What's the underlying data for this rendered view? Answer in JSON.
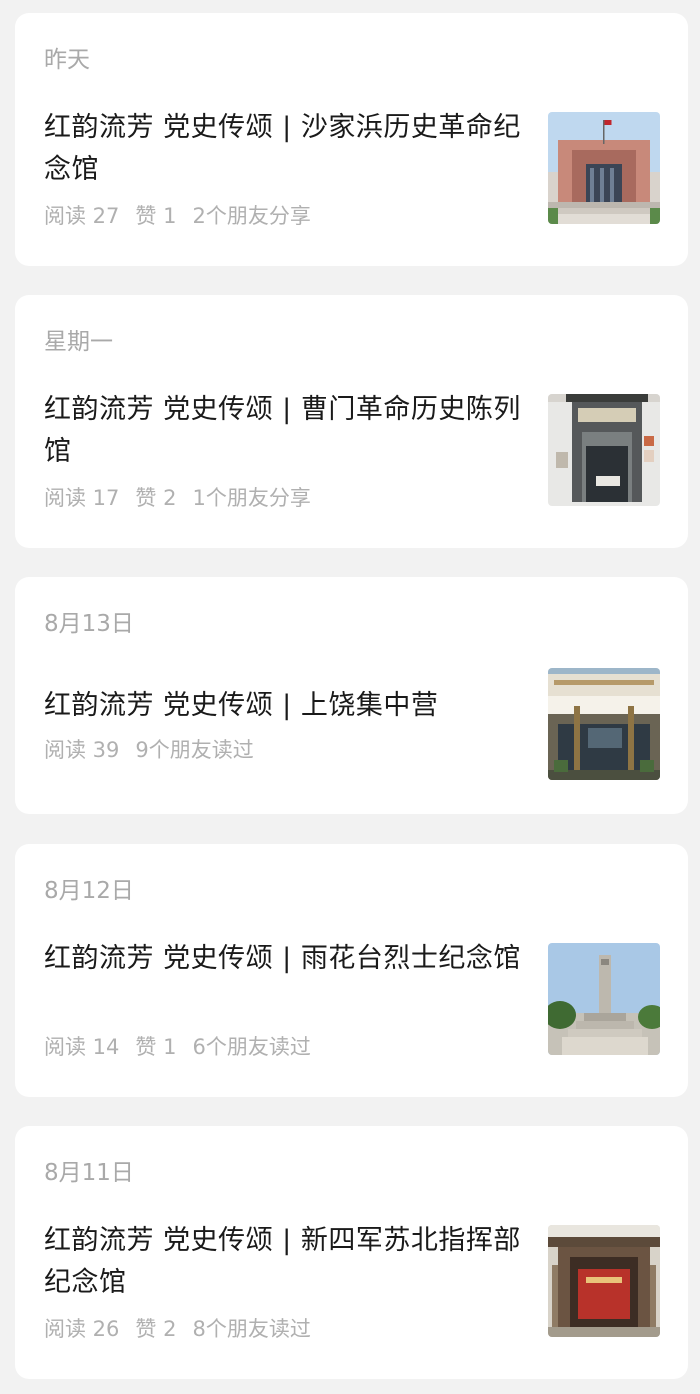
{
  "articles": [
    {
      "date": "昨天",
      "title": "红韵流芳 党史传颂 | 沙家浜历史革命纪念馆",
      "reads": "阅读 27",
      "likes": "赞 1",
      "friends": "2个朋友分享",
      "thumb_icon": "memorial-hall-photo"
    },
    {
      "date": "星期一",
      "title": "红韵流芳 党史传颂 | 曹门革命历史陈列馆",
      "reads": "阅读 17",
      "likes": "赞 2",
      "friends": "1个朋友分享",
      "thumb_icon": "exhibition-gate-photo"
    },
    {
      "date": "8月13日",
      "title": "红韵流芳 党史传颂 | 上饶集中营",
      "reads": "阅读 39",
      "likes": "",
      "friends": "9个朋友读过",
      "thumb_icon": "memorial-building-photo"
    },
    {
      "date": "8月12日",
      "title": "红韵流芳 党史传颂 | 雨花台烈士纪念馆",
      "reads": "阅读 14",
      "likes": "赞 1",
      "friends": "6个朋友读过",
      "thumb_icon": "monument-tower-photo"
    },
    {
      "date": "8月11日",
      "title": "红韵流芳 党史传颂 | 新四军苏北指挥部纪念馆",
      "reads": "阅读 26",
      "likes": "赞 2",
      "friends": "8个朋友读过",
      "thumb_icon": "red-gate-photo"
    }
  ]
}
